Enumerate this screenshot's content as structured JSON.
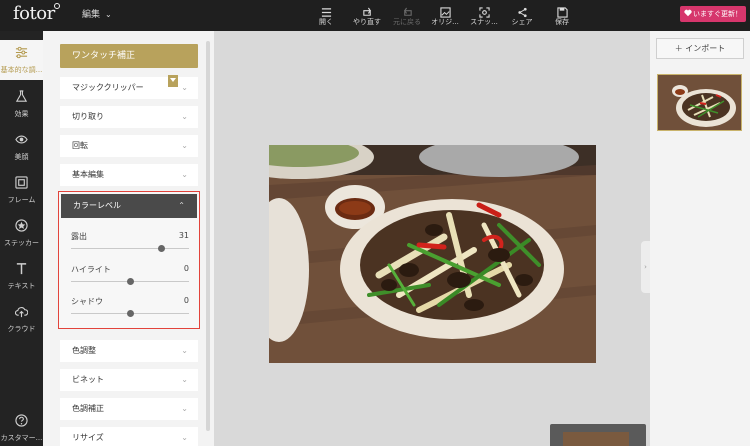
{
  "app": {
    "logo_text": "fotor",
    "edit_menu_label": "編集"
  },
  "toolbar": {
    "open_label": "開く",
    "redo_label": "やり直す",
    "undo_label": "元に戻る",
    "original_label": "オリジ...",
    "snapshot_label": "スナッ...",
    "share_label": "シェア",
    "save_label": "保存",
    "upgrade_label": "いますぐ更新！"
  },
  "rail": {
    "items": [
      {
        "label": "基本的な調...",
        "icon": "sliders-icon"
      },
      {
        "label": "効果",
        "icon": "flask-icon"
      },
      {
        "label": "美顔",
        "icon": "eye-icon"
      },
      {
        "label": "フレーム",
        "icon": "frame-icon"
      },
      {
        "label": "ステッカー",
        "icon": "sticker-icon"
      },
      {
        "label": "テキスト",
        "icon": "text-icon"
      },
      {
        "label": "クラウド",
        "icon": "cloud-icon"
      },
      {
        "label": "カスタマー...",
        "icon": "help-icon"
      }
    ]
  },
  "panel": {
    "one_tap_label": "ワンタッチ補正",
    "magic_clipper_label": "マジッククリッパー",
    "crop_label": "切り取り",
    "rotate_label": "回転",
    "basic_edit_label": "基本編集",
    "color_level": {
      "title": "カラーレベル",
      "exposure": {
        "label": "露出",
        "value": "31",
        "level": 0.76
      },
      "highlight": {
        "label": "ハイライト",
        "value": "0",
        "level": 0.5
      },
      "shadow": {
        "label": "シャドウ",
        "value": "0",
        "level": 0.5
      }
    },
    "color_tone_label": "色調整",
    "vignette_label": "ビネット",
    "color_correction_label": "色調補正",
    "resize_label": "リサイズ"
  },
  "right_panel": {
    "import_label": "インポート"
  },
  "colors": {
    "accent_gold": "#b8a25c",
    "upgrade_pink": "#d6366c",
    "highlight_border": "#e2433b"
  }
}
